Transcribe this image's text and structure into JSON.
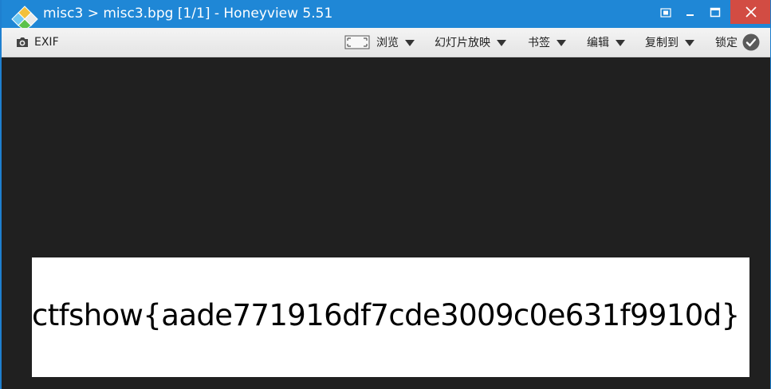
{
  "window": {
    "title": "misc3 > misc3.bpg [1/1] - Honeyview 5.51",
    "controls": {
      "pin_icon": "pin-icon",
      "minimize_icon": "minimize-icon",
      "maximize_icon": "maximize-icon",
      "close_icon": "close-icon"
    }
  },
  "toolbar": {
    "exif_label": "EXIF",
    "browse_label": "浏览",
    "slideshow_label": "幻灯片放映",
    "bookmark_label": "书签",
    "edit_label": "编辑",
    "copyto_label": "复制到",
    "lock_label": "锁定"
  },
  "image": {
    "text": "ctfshow{aade771916df7cde3009c0e631f9910d}"
  },
  "colors": {
    "titlebar": "#1f87d6",
    "close_button": "#d24c43",
    "viewer_background": "#202020",
    "image_background": "#ffffff"
  }
}
